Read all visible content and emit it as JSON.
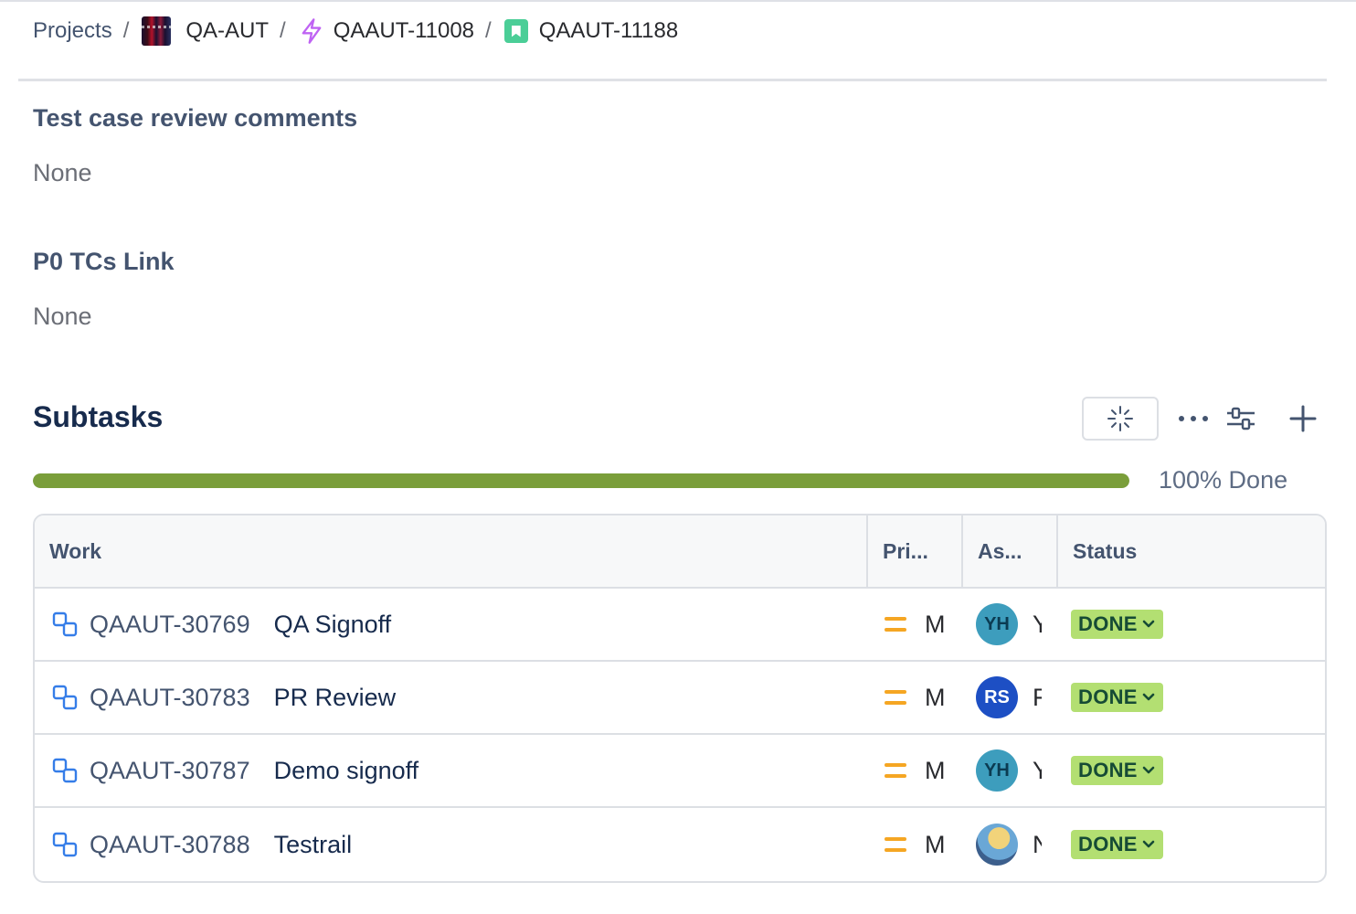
{
  "breadcrumb": {
    "projects": "Projects",
    "project": "QA-AUT",
    "epic": "QAAUT-11008",
    "story": "QAAUT-11188",
    "separator": "/"
  },
  "fields": [
    {
      "label": "Test case review comments",
      "value": "None"
    },
    {
      "label": "P0 TCs Link",
      "value": "None"
    }
  ],
  "subtasks": {
    "title": "Subtasks",
    "progress_percent": 100,
    "progress_label": "100% Done",
    "columns": {
      "work": "Work",
      "priority": "Pri...",
      "assignee": "As...",
      "status": "Status"
    },
    "rows": [
      {
        "key": "QAAUT-30769",
        "summary": "QA Signoff",
        "priority": "M",
        "avatar": "YH",
        "avatar_color": "#3d9dbd",
        "assignee_initial": "Y",
        "status": "DONE"
      },
      {
        "key": "QAAUT-30783",
        "summary": "PR Review",
        "priority": "M",
        "avatar": "RS",
        "avatar_color": "#1d4fc4",
        "assignee_initial": "F",
        "status": "DONE"
      },
      {
        "key": "QAAUT-30787",
        "summary": "Demo signoff",
        "priority": "M",
        "avatar": "YH",
        "avatar_color": "#3d9dbd",
        "assignee_initial": "Y",
        "status": "DONE"
      },
      {
        "key": "QAAUT-30788",
        "summary": "Testrail",
        "priority": "M",
        "avatar": "",
        "avatar_color": "photo",
        "assignee_initial": "N",
        "status": "DONE"
      }
    ]
  },
  "colors": {
    "progress": "#7a9e3a",
    "done_lozenge": "#b3df72",
    "priority_medium": "#f5a623",
    "story": "#4bce97",
    "epic": "#bf63f3",
    "subtask": "#357de8"
  }
}
